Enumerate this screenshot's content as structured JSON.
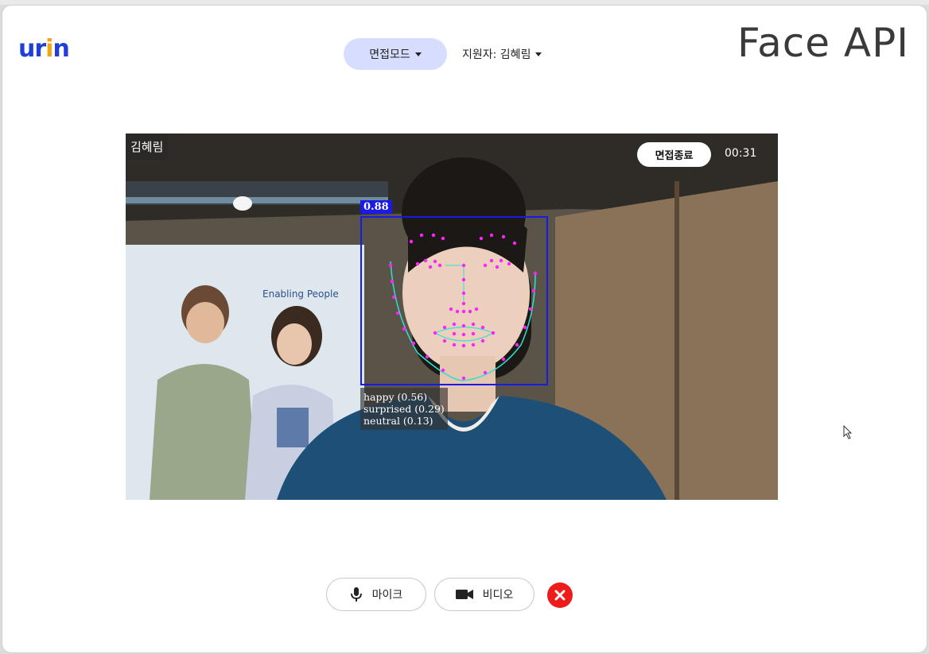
{
  "header": {
    "logo_text": "urn",
    "mode_label": "면접모드",
    "applicant_label": "지원자: 김혜림",
    "brand_title": "Face API"
  },
  "video": {
    "participant_name": "김혜림",
    "end_interview_label": "면접종료",
    "timer": "00:31",
    "poster_text": "Enabling People",
    "detection": {
      "confidence": "0.88",
      "emotions": [
        "happy (0.56)",
        "surprised (0.29)",
        "neutral (0.13)"
      ]
    }
  },
  "controls": {
    "mic_label": "마이크",
    "video_label": "비디오",
    "leave_icon": "close-icon"
  },
  "colors": {
    "brand_blue": "#1f3fd6",
    "mode_button_bg": "#d6ddff",
    "detection_box": "#1a1ae6",
    "landmark": "#ff22ff",
    "jawline": "#33e0d0",
    "close_red": "#ee1b1b"
  }
}
